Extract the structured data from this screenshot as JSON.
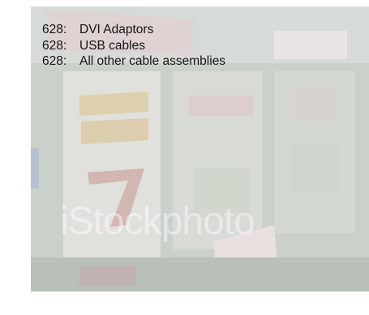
{
  "captions": [
    {
      "code": "628:",
      "text": "DVI Adaptors"
    },
    {
      "code": "628:",
      "text": "USB cables"
    },
    {
      "code": "628:",
      "text": "All other cable assemblies"
    }
  ],
  "image": {
    "subject": "slot machine reels",
    "watermark": "iStockphoto",
    "tint": "#c9cfc8"
  }
}
